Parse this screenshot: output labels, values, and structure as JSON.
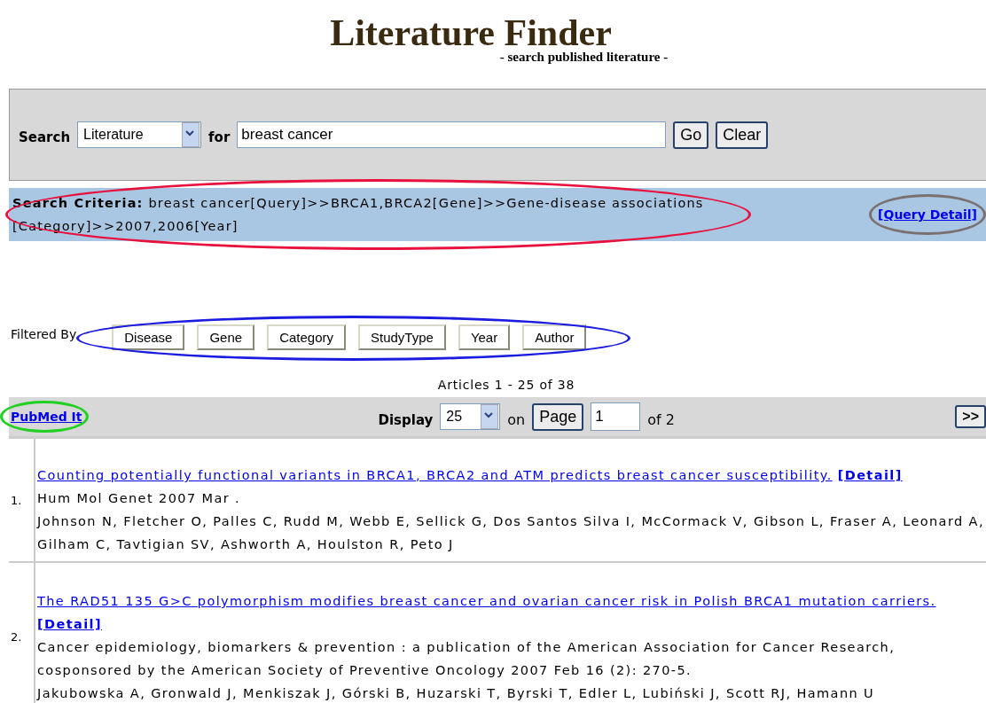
{
  "header": {
    "title": "Literature Finder",
    "subtitle": "- search published literature -"
  },
  "search": {
    "label": "Search",
    "scope": "Literature",
    "for_label": "for",
    "query": "breast cancer",
    "buttons": [
      "Go",
      "Clear"
    ]
  },
  "criteria": {
    "label": "Search Criteria:",
    "text": "breast cancer[Query]>>BRCA1,BRCA2[Gene]>>Gene-disease associations [Category]>>2007,2006[Year]",
    "link": "[Query Detail]"
  },
  "filters": {
    "label": "Filtered By",
    "buttons": [
      "Disease",
      "Gene",
      "Category",
      "StudyType",
      "Year",
      "Author"
    ]
  },
  "results": {
    "count": "Articles 1 - 25 of 38",
    "pubmed_link": "PubMed It",
    "display_label": "Display",
    "page_size": "25",
    "on_label": "on",
    "page_button": "Page",
    "page": "1",
    "of_pages": "of 2",
    "next": ">>"
  },
  "annotations": [
    {
      "kind": "criteria",
      "color": "#e8103c"
    },
    {
      "kind": "query_detail",
      "color": "#7a7070"
    },
    {
      "kind": "filters",
      "color": "#1c1ce0"
    },
    {
      "kind": "pubmed",
      "color": "#22d022"
    }
  ],
  "articles": [
    {
      "number": "1.",
      "title": "Counting potentially functional variants in BRCA1, BRCA2 and ATM predicts breast cancer susceptibility.",
      "detail": "[Detail]",
      "source": "Hum Mol Genet 2007 Mar .",
      "authors": "Johnson N, Fletcher O, Palles C, Rudd M, Webb E, Sellick G, Dos Santos Silva I, McCormack V, Gibson L, Fraser A, Leonard A, Gilham C, Tavtigian SV, Ashworth A, Houlston R, Peto J"
    },
    {
      "number": "2.",
      "title": "The RAD51 135 G>C polymorphism modifies breast cancer and ovarian cancer risk in Polish BRCA1 mutation carriers.",
      "detail": "[Detail]",
      "source": "Cancer epidemiology, biomarkers & prevention : a publication of the American Association for Cancer Research, cosponsored by the American Society of Preventive Oncology 2007 Feb 16 (2): 270-5.",
      "authors": "Jakubowska A, Gronwald J, Menkiszak J, Górski B, Huzarski T, Byrski T, Edler L, Lubiński J, Scott RJ, Hamann U"
    }
  ]
}
